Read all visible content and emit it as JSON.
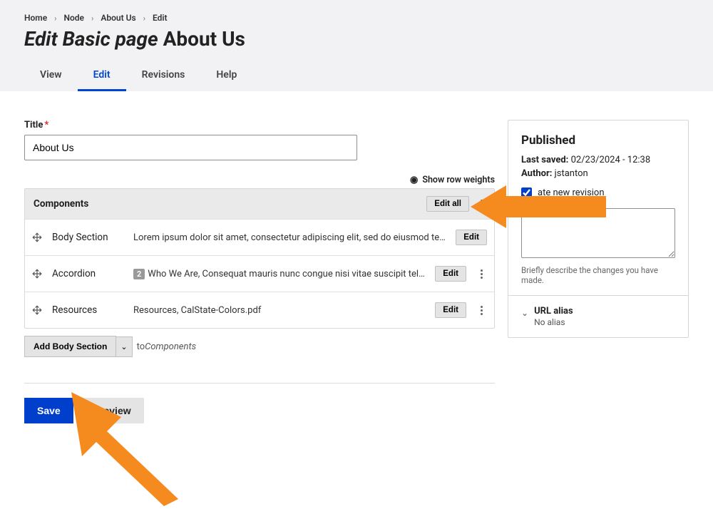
{
  "breadcrumb": [
    "Home",
    "Node",
    "About Us",
    "Edit"
  ],
  "page_title_prefix": "Edit Basic page",
  "page_title_suffix": "About Us",
  "tabs": {
    "view": "View",
    "edit": "Edit",
    "revisions": "Revisions",
    "help": "Help"
  },
  "title_field": {
    "label": "Title",
    "value": "About Us"
  },
  "row_weights_label": "Show row weights",
  "components": {
    "heading": "Components",
    "edit_all_label": "Edit all",
    "rows": [
      {
        "name": "Body Section",
        "summary": "Lorem ipsum dolor sit amet, consectetur adipiscing elit, sed do eiusmod tempor in…",
        "edit": "Edit",
        "badge": ""
      },
      {
        "name": "Accordion",
        "summary": "Who We Are, Consequat mauris nunc congue nisi vitae suscipit tellus. Mollis nu…",
        "edit": "Edit",
        "badge": "2"
      },
      {
        "name": "Resources",
        "summary": "Resources, CalState-Colors.pdf",
        "edit": "Edit",
        "badge": ""
      }
    ],
    "add_button": "Add Body Section",
    "add_suffix_to": "to",
    "add_suffix_target": "Components"
  },
  "actions": {
    "save": "Save",
    "preview": "Preview"
  },
  "sidebar": {
    "published_heading": "Published",
    "last_saved_label": "Last saved:",
    "last_saved_value": "02/23/2024 - 12:38",
    "author_label": "Author:",
    "author_value": "jstanton",
    "create_revision_label": "ate new revision",
    "revision_help": "Briefly describe the changes you have made.",
    "url_alias_title": "URL alias",
    "url_alias_sub": "No alias"
  }
}
